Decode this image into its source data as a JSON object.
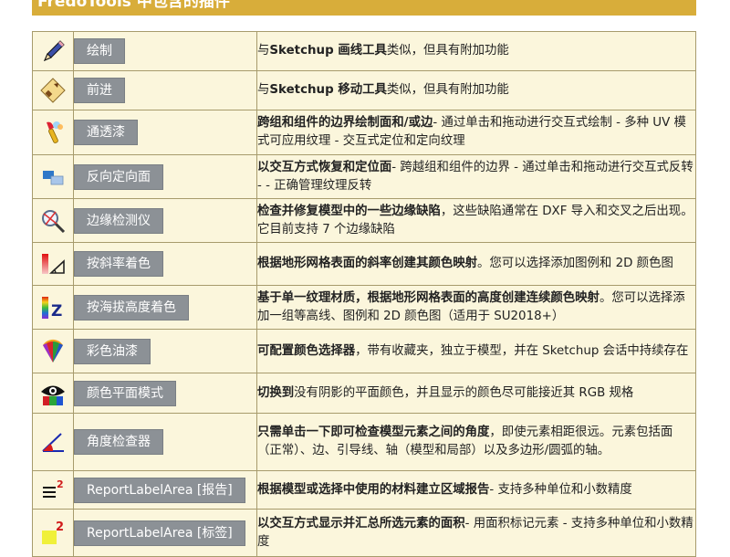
{
  "header": {
    "title": "FredoTools 中包含的插件"
  },
  "plugins": [
    {
      "icon": "pencil-icon",
      "name": "绘制",
      "desc_bold": "",
      "desc_rest": "",
      "desc_pre": "与",
      "desc_mid_bold": "Sketchup 画线工具",
      "desc_post": "类似，但具有附加功能"
    },
    {
      "icon": "arrow-push-icon",
      "name": "前进",
      "desc_bold": "",
      "desc_rest": "",
      "desc_pre": "与",
      "desc_mid_bold": "Sketchup 移动工具",
      "desc_post": "类似，但具有附加功能"
    },
    {
      "icon": "paint-brush-icon",
      "name": "通透漆",
      "desc_bold": "跨组和组件的边界绘制面和/或边",
      "desc_rest": "- 通过单击和拖动进行交互式绘制 - 多种 UV 模式可应用纹理 - 交互式定位和定向纹理"
    },
    {
      "icon": "face-orient-icon",
      "name": "反向定向面",
      "desc_bold": "以交互方式恢复和定位面",
      "desc_rest": "- 跨越组和组件的边界 - 通过单击和拖动进行交互式反转 - - 正确管理纹理反转"
    },
    {
      "icon": "magnifier-edge-icon",
      "name": "边缘检测仪",
      "desc_bold": "检查并修复模型中的一些边缘缺陷",
      "desc_rest": "，这些缺陷通常在 DXF 导入和交叉之后出现。它目前支持 7 个边缘缺陷"
    },
    {
      "icon": "slope-color-icon",
      "name": "按斜率着色",
      "desc_bold": "根据地形网格表面的斜率创建其颜色映射",
      "desc_rest": "。您可以选择添加图例和 2D 颜色图"
    },
    {
      "icon": "altitude-z-icon",
      "name": "按海拔高度着色",
      "desc_bold": "基于单一纹理材质，根据地形网格表面的高度创建连续颜色映射",
      "desc_rest": "。您可以选择添加一组等高线、图例和 2D 颜色图（适用于 SU2018+）"
    },
    {
      "icon": "color-fan-icon",
      "name": "彩色油漆",
      "desc_bold": "可配置颜色选择器",
      "desc_rest": "，带有收藏夹，独立于模型，并在 Sketchup 会话中持续存在"
    },
    {
      "icon": "eye-color-icon",
      "name": "颜色平面模式",
      "desc_bold": "切换到",
      "desc_rest": "没有阴影的平面颜色，并且显示的颜色尽可能接近其 RGB 规格"
    },
    {
      "icon": "angle-icon",
      "name": "角度检查器",
      "desc_bold": "只需单击一下即可检查模型元素之间的角度",
      "desc_rest": "，即使元素相距很远。元素包括面（正常）、边、引导线、轴（模型和局部）以及多边形/圆弧的轴。"
    },
    {
      "icon": "area-report-icon",
      "name": "ReportLabelArea [报告]",
      "desc_bold": "根据模型或选择中使用的材料建立区域报告",
      "desc_rest": "- 支持多种单位和小数精度"
    },
    {
      "icon": "area-label-icon",
      "name": "ReportLabelArea [标签]",
      "desc_bold": "以交互方式显示并汇总所选元素的面积",
      "desc_rest": "- 用面积标记元素 - 支持多种单位和小数精度"
    }
  ]
}
